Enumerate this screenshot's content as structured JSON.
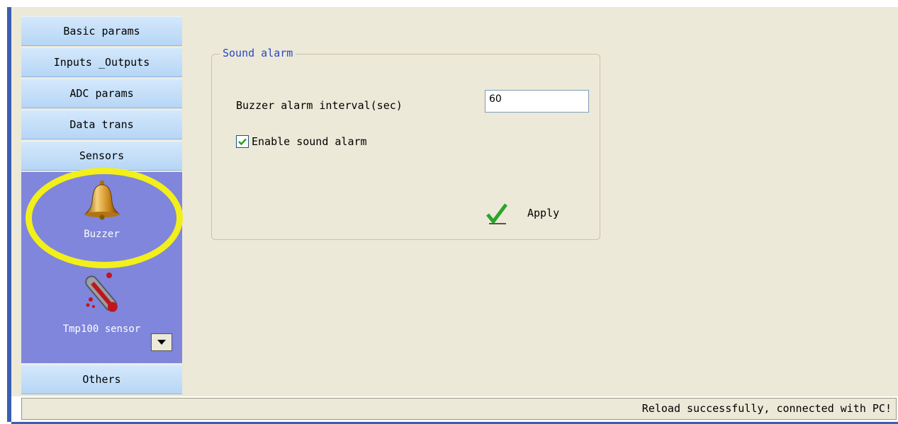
{
  "nav": {
    "items": [
      "Basic params",
      "Inputs _Outputs",
      "ADC params",
      "Data trans",
      "Sensors"
    ],
    "panel_items": [
      {
        "label": "Buzzer",
        "icon": "bell-icon"
      },
      {
        "label": "Tmp100 sensor",
        "icon": "thermometer-icon"
      }
    ],
    "bottom_item": "Others"
  },
  "group": {
    "title": "Sound alarm",
    "interval_label": "Buzzer alarm interval(sec)",
    "interval_value": "60",
    "enable_label": "Enable sound alarm",
    "enable_checked": true,
    "apply_label": "Apply"
  },
  "status": {
    "message": "Reload successfully, connected with PC!"
  },
  "colors": {
    "nav_button": "#c5dff9",
    "nav_panel": "#7f86db",
    "highlight_ring": "#f2ef1a",
    "group_title": "#2947c4",
    "background": "#ece9d8"
  }
}
